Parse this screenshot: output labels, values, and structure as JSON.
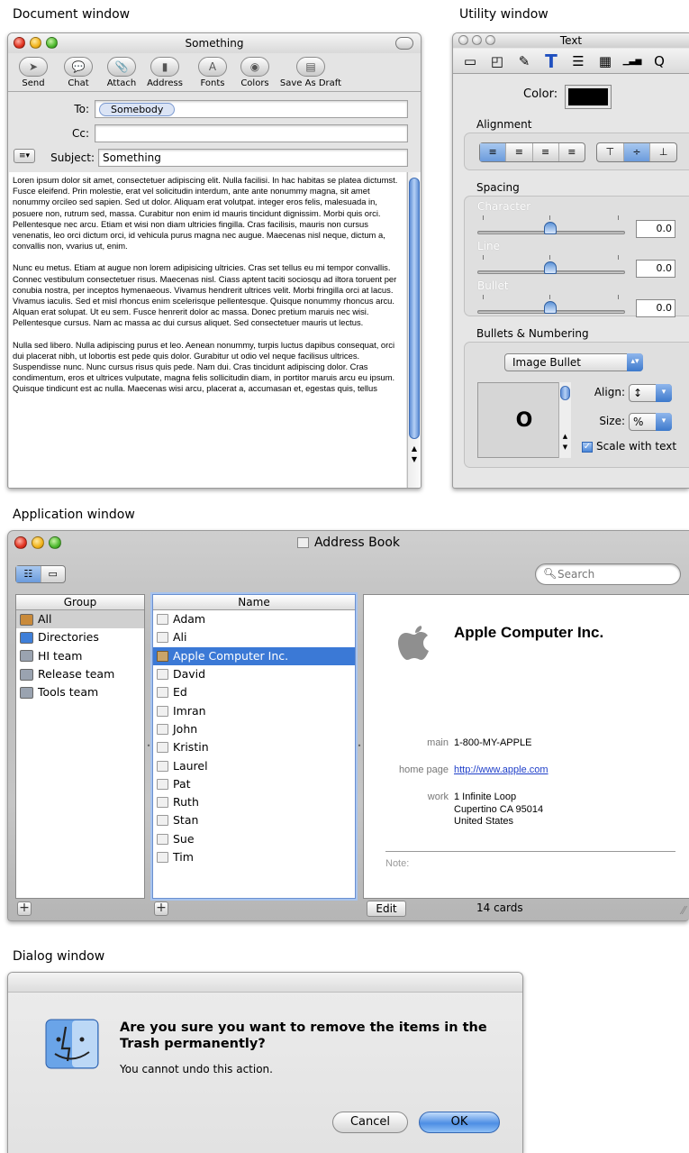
{
  "sections": {
    "document": "Document window",
    "utility": "Utility window",
    "application": "Application window",
    "dialog": "Dialog window"
  },
  "mail": {
    "title": "Something",
    "toolbar": [
      {
        "label": "Send",
        "icon": "send-icon",
        "glyph": "➤"
      },
      {
        "label": "Chat",
        "icon": "chat-icon",
        "glyph": "💬"
      },
      {
        "label": "Attach",
        "icon": "paperclip-icon",
        "glyph": "📎"
      },
      {
        "label": "Address",
        "icon": "address-book-icon",
        "glyph": "▮"
      },
      {
        "label": "Fonts",
        "icon": "fonts-icon",
        "glyph": "A"
      },
      {
        "label": "Colors",
        "icon": "color-wheel-icon",
        "glyph": "◉"
      },
      {
        "label": "Save As Draft",
        "icon": "draft-icon",
        "glyph": "▤"
      }
    ],
    "to_label": "To:",
    "to_value": "Somebody",
    "cc_label": "Cc:",
    "cc_value": "",
    "subject_label": "Subject:",
    "subject_value": "Something",
    "body": [
      "Loren ipsum dolor sit amet, consectetuer adipiscing elit.  Nulla facilisi.  In hac habitas se platea dictumst.  Fusce eleifend.  Prin molestie, erat vel solicitudin interdum, ante ante nonummy magna, sit amet nonummy orcileo sed sapien.  Sed ut dolor.  Aliquam erat volutpat.  integer eros felis, malesuada in, posuere non, rutrum sed, massa. Curabitur non enim id mauris tincidunt dignissim.  Morbi quis orci.  Pellentesque nec arcu.  Etiam et wisi non diam ultricies fingilla.  Cras facilisis, mauris non cursus venenatis, leo orci dictum orci, id vehicula purus magna nec augue.  Maecenas nisl neque, dictum a, convallis non, vvarius ut, enim.",
      "Nunc eu metus.  Etiam at augue non lorem adipisicing ultricies.  Cras set tellus eu mi tempor convallis.  Connec vestibulum consectetuer risus.  Maecenas nisl.  Ciass aptent taciti sociosqu ad iltora toruent per conubia nostra, per inceptos hymenaeous.  Vivamus hendrerit ultrices velit.  Morbi fringilla orci at lacus.  Vivamus iaculis.  Sed et misl rhoncus enim scelerisque pellentesque.  Quisque nonummy rhoncus arcu.  Alquan erat solupat.  Ut eu sem.  Fusce henrerit dolor ac massa.  Donec pretium maruis nec wisi.  Pellentesque cursus.  Nam ac massa ac dui cursus aliquet.  Sed consectetuer mauris ut lectus.",
      "Nulla sed libero.  Nulla adipiscing purus et leo.  Aenean nonummy, turpis luctus dapibus consequat, orci dui placerat nibh, ut lobortis est pede quis dolor.  Gurabitur ut odio vel neque facilisus ultrices.  Suspendisse nunc.  Nunc cursus risus quis pede. Nam dui.  Cras tincidunt adipiscing dolor.  Cras condimentum, eros et ultrices vulputate, magna felis sollicitudin diam, in portitor maruis arcu eu ipsum.  Quisque tindicunt est ac nulla.  Maecenas wisi arcu, placerat a, accumasan et, egestas quis, tellus"
    ]
  },
  "text_panel": {
    "title": "Text",
    "tools": [
      {
        "icon": "box-icon",
        "glyph": "▭"
      },
      {
        "icon": "shapes-icon",
        "glyph": "◰"
      },
      {
        "icon": "pencil-icon",
        "glyph": "✎"
      },
      {
        "icon": "text-icon",
        "glyph": "T"
      },
      {
        "icon": "list-icon",
        "glyph": "☰"
      },
      {
        "icon": "table-icon",
        "glyph": "▦"
      },
      {
        "icon": "chart-icon",
        "glyph": "▁▃▅"
      },
      {
        "icon": "search-icon",
        "glyph": "Q"
      }
    ],
    "color_label": "Color:",
    "color_value": "#000000",
    "alignment_label": "Alignment",
    "align_buttons": [
      "≡",
      "≡",
      "≡",
      "≡"
    ],
    "valign_buttons": [
      "⊤",
      "÷",
      "⊥"
    ],
    "spacing_label": "Spacing",
    "character_label": "Character",
    "character_value": "0.0",
    "line_label": "Line",
    "line_value": "0.0",
    "bullet_label": "Bullet",
    "bullet_value": "0.0",
    "bullets_label": "Bullets & Numbering",
    "bullet_type": "Image Bullet",
    "bullet_preview": "O",
    "align_field_label": "Align:",
    "align_field_value": "↕",
    "size_label": "Size:",
    "size_value": "%",
    "scale_label": "Scale with text"
  },
  "address_book": {
    "title": "Address Book",
    "search_placeholder": "Search",
    "group_header": "Group",
    "name_header": "Name",
    "groups": [
      "All",
      "Directories",
      "HI team",
      "Release team",
      "Tools team"
    ],
    "names": [
      "Adam",
      "Ali",
      "Apple Computer Inc.",
      "David",
      "Ed",
      "Imran",
      "John",
      "Kristin",
      "Laurel",
      "Pat",
      "Ruth",
      "Stan",
      "Sue",
      "Tim"
    ],
    "selected_name": "Apple Computer Inc.",
    "card": {
      "company": "Apple Computer Inc.",
      "main_label": "main",
      "main_value": "1-800-MY-APPLE",
      "homepage_label": "home page",
      "homepage_value": "http://www.apple.com",
      "work_label": "work",
      "work_line1": "1 Infinite Loop",
      "work_line2": "Cupertino CA 95014",
      "work_line3": "United States",
      "note_label": "Note:"
    },
    "edit_label": "Edit",
    "count": "14 cards"
  },
  "dialog": {
    "message": "Are you sure you want to remove the items in the Trash permanently?",
    "detail": "You cannot undo this action.",
    "cancel": "Cancel",
    "ok": "OK"
  }
}
